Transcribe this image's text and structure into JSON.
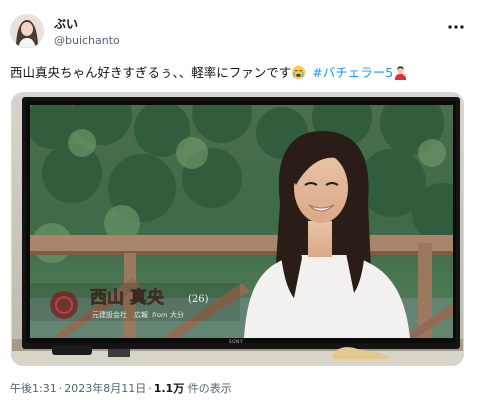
{
  "author": {
    "display_name": "ぶい",
    "handle": "@buichanto"
  },
  "tweet": {
    "text": "西山真央ちゃん好きすぎるぅ、、軽率にファンです",
    "hashtag": "#バチェラー5",
    "emoji_crying": "crying-face-icon",
    "emoji_person": "man-tipping-hand-icon"
  },
  "media": {
    "caption_name": "西山 真央",
    "caption_age": "(26)",
    "caption_sub_job": "元建設会社　広報",
    "caption_sub_from": "from",
    "caption_sub_place": "大分",
    "tv_brand": "SONY"
  },
  "meta": {
    "time": "午後1:31",
    "date": "2023年8月11日",
    "dot": "·",
    "views_count": "1.1万",
    "views_label": "件の表示"
  },
  "colors": {
    "text": "#0f1419",
    "secondary": "#536471",
    "link": "#1d9bf0",
    "border": "#cfd9de"
  },
  "icons": {
    "more": "more-horizontal-icon",
    "avatar": "avatar"
  }
}
